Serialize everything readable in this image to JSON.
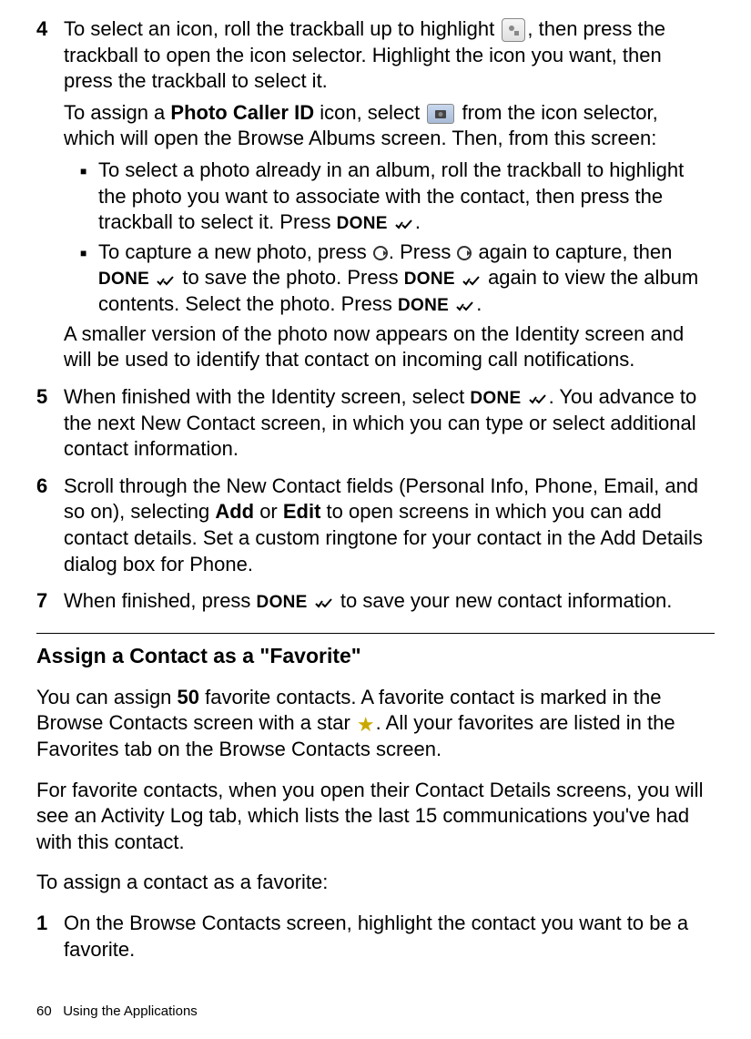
{
  "steps": {
    "s4": {
      "num": "4",
      "p1a": "To select an icon, roll the trackball up to highlight ",
      "p1b": ", then press the trackball to open the icon selector. Highlight the icon you want, then press the trackball to select it.",
      "p2a": "To assign a ",
      "p2b": "Photo Caller ID",
      "p2c": " icon, select ",
      "p2d": " from the icon selector, which will open the Browse Albums screen. Then, from this screen:",
      "sub1a": "To select a photo already in an album, roll the trackball to highlight the photo you want to associate with the contact, then press the trackball to select it. Press ",
      "done": "DONE",
      "period": ".",
      "sub2a": "To capture a new photo, press ",
      "sub2b": ". Press ",
      "sub2c": " again to capture, then ",
      "sub2d": " to save the photo. Press ",
      "sub2e": " again to view the album contents. Select the photo. Press ",
      "p3": "A smaller version of the photo now appears on the Identity screen and will be used to identify that contact on incoming call notifications."
    },
    "s5": {
      "num": "5",
      "p1a": "When finished with the Identity screen, select ",
      "p1b": ". You advance to the next New Contact screen, in which you can type or select additional contact information."
    },
    "s6": {
      "num": "6",
      "p1a": "Scroll through the New Contact fields (Personal Info, Phone, Email, and so on), selecting ",
      "add": "Add",
      "or": " or ",
      "edit": "Edit",
      "p1b": " to open screens in which you can add contact details. Set a custom ringtone for your contact in the Add Details dialog box for Phone."
    },
    "s7": {
      "num": "7",
      "p1a": "When finished, press ",
      "p1b": " to save your new contact information."
    }
  },
  "section": {
    "heading": "Assign a Contact as a \"Favorite\"",
    "p1a": "You can assign ",
    "fifty": "50",
    "p1b": " favorite contacts. A favorite contact is marked in the Browse Contacts screen with a star ",
    "p1c": ". All your favorites are listed in the Favorites tab on the Browse Contacts screen.",
    "p2": "For favorite contacts, when you open their Contact Details screens, you will see an Activity Log tab, which lists the last 15 communications you've had with this contact.",
    "p3": "To assign a contact as a favorite:",
    "step1num": "1",
    "step1": "On the Browse Contacts screen, highlight the contact you want to be a favorite."
  },
  "footer": {
    "page": "60",
    "title": "Using the Applications"
  }
}
